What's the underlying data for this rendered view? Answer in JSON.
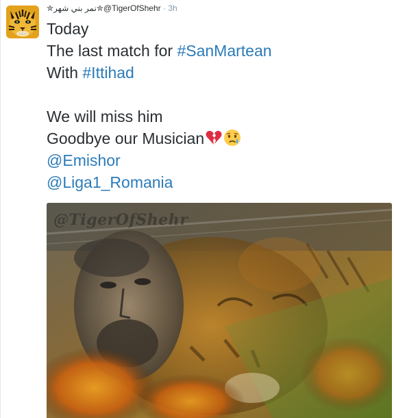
{
  "tweet": {
    "author": {
      "display_name": "✮نمر بني شهر✮",
      "handle": "@TigerOfShehr"
    },
    "separator": "·",
    "time": "3h",
    "lines": [
      {
        "segments": [
          {
            "text": "Today"
          }
        ]
      },
      {
        "segments": [
          {
            "text": "The last match for "
          },
          {
            "text": "#SanMartean",
            "link": true
          }
        ]
      },
      {
        "segments": [
          {
            "text": "With "
          },
          {
            "text": "#Ittihad",
            "link": true
          }
        ]
      },
      {
        "segments": []
      },
      {
        "segments": [
          {
            "text": "We will miss him"
          }
        ]
      },
      {
        "segments": [
          {
            "text": "Goodbye our Musician"
          },
          {
            "emoji": "broken-heart-icon"
          },
          {
            "emoji": "crying-face-icon"
          }
        ]
      },
      {
        "segments": [
          {
            "text": "@Emishor",
            "link": true
          }
        ]
      },
      {
        "segments": [
          {
            "text": "@Liga1_Romania",
            "link": true
          }
        ]
      }
    ],
    "media": {
      "watermark": "@TigerOfShehr"
    }
  },
  "colors": {
    "text": "#292f33",
    "link": "#2b7bb9",
    "muted": "#8899a6"
  }
}
